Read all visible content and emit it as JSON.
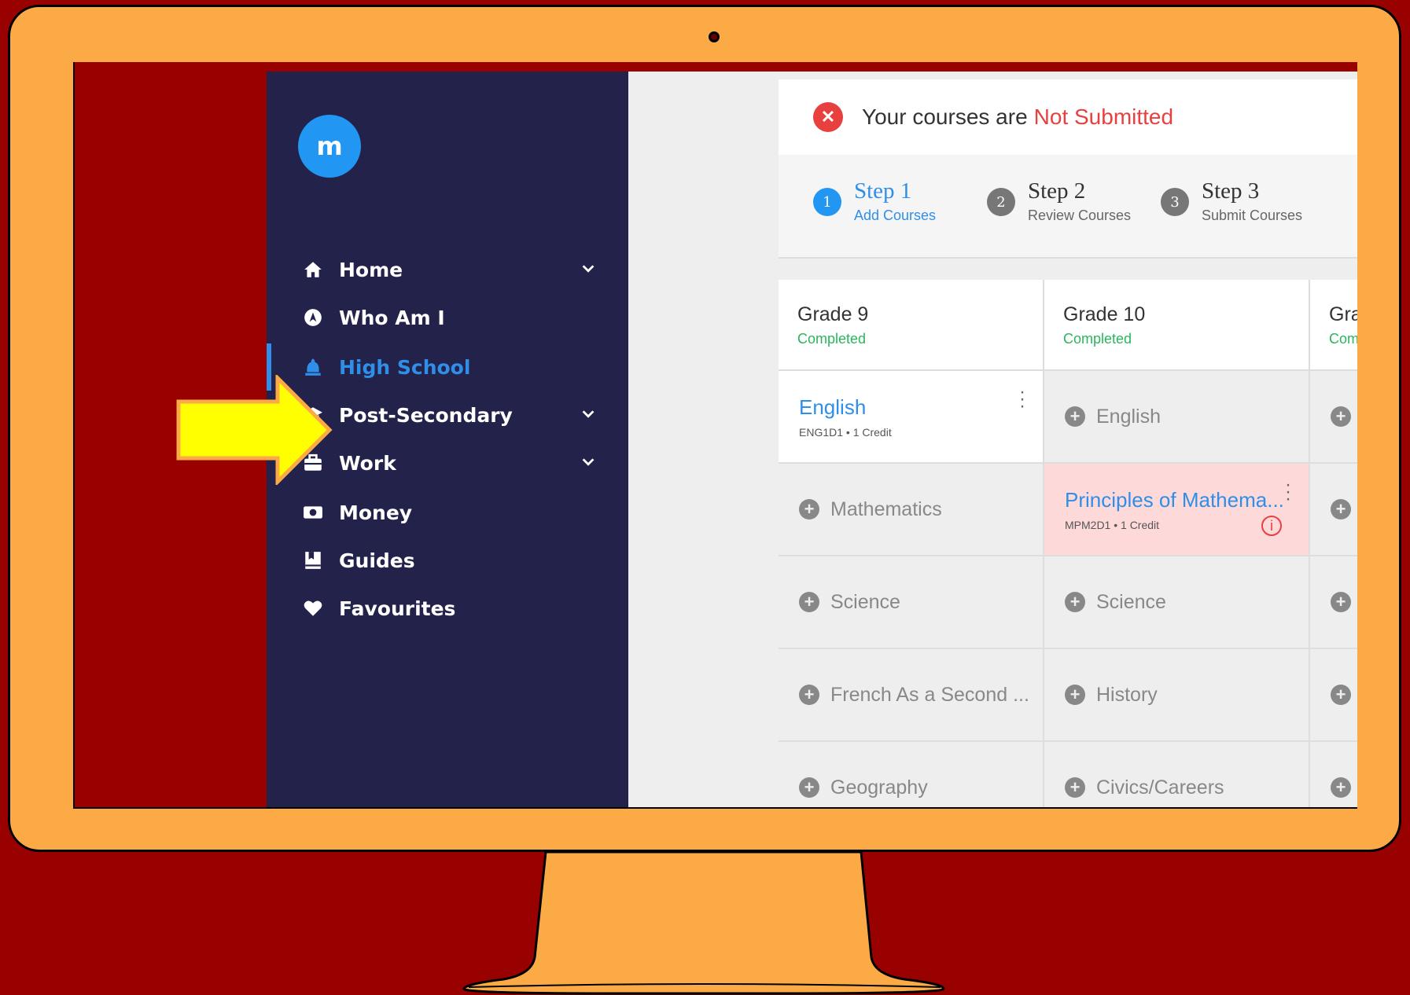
{
  "brand": {
    "logo_text": "m"
  },
  "sidebar": {
    "items": [
      {
        "label": "Home",
        "icon": "home-icon",
        "expandable": true
      },
      {
        "label": "Who Am I",
        "icon": "compass-icon",
        "expandable": false
      },
      {
        "label": "High School",
        "icon": "school-bell-icon",
        "expandable": false,
        "active": true
      },
      {
        "label": "Post-Secondary",
        "icon": "graduation-cap-icon",
        "expandable": true
      },
      {
        "label": "Work",
        "icon": "briefcase-icon",
        "expandable": true
      },
      {
        "label": "Money",
        "icon": "money-icon",
        "expandable": false
      },
      {
        "label": "Guides",
        "icon": "book-icon",
        "expandable": false
      },
      {
        "label": "Favourites",
        "icon": "heart-icon",
        "expandable": false
      }
    ]
  },
  "status": {
    "prefix": "Your courses are",
    "value": "Not Submitted"
  },
  "steps": [
    {
      "number": "1",
      "title": "Step 1",
      "subtitle": "Add Courses",
      "active": true
    },
    {
      "number": "2",
      "title": "Step 2",
      "subtitle": "Review Courses"
    },
    {
      "number": "3",
      "title": "Step 3",
      "subtitle": "Submit Courses"
    }
  ],
  "grades": [
    {
      "title": "Grade 9",
      "status": "Completed",
      "courses": [
        {
          "name": "English",
          "meta": "ENG1D1 • 1 Credit",
          "added": true
        },
        {
          "name": "Mathematics"
        },
        {
          "name": "Science"
        },
        {
          "name": "French As a Second ..."
        },
        {
          "name": "Geography"
        }
      ]
    },
    {
      "title": "Grade 10",
      "status": "Completed",
      "courses": [
        {
          "name": "English"
        },
        {
          "name": "Principles of Mathema...",
          "meta": "MPM2D1 • 1 Credit",
          "added": true,
          "error": true
        },
        {
          "name": "Science"
        },
        {
          "name": "History"
        },
        {
          "name": "Civics/Careers"
        }
      ]
    },
    {
      "title": "Gra",
      "status": "Com"
    }
  ],
  "colors": {
    "accent": "#2f8fe8",
    "error": "#e8403f",
    "success": "#2bb55c",
    "sidebar": "#23224b",
    "monitor": "#FBAA45",
    "background": "#990000",
    "arrow": "#FFFF00"
  }
}
